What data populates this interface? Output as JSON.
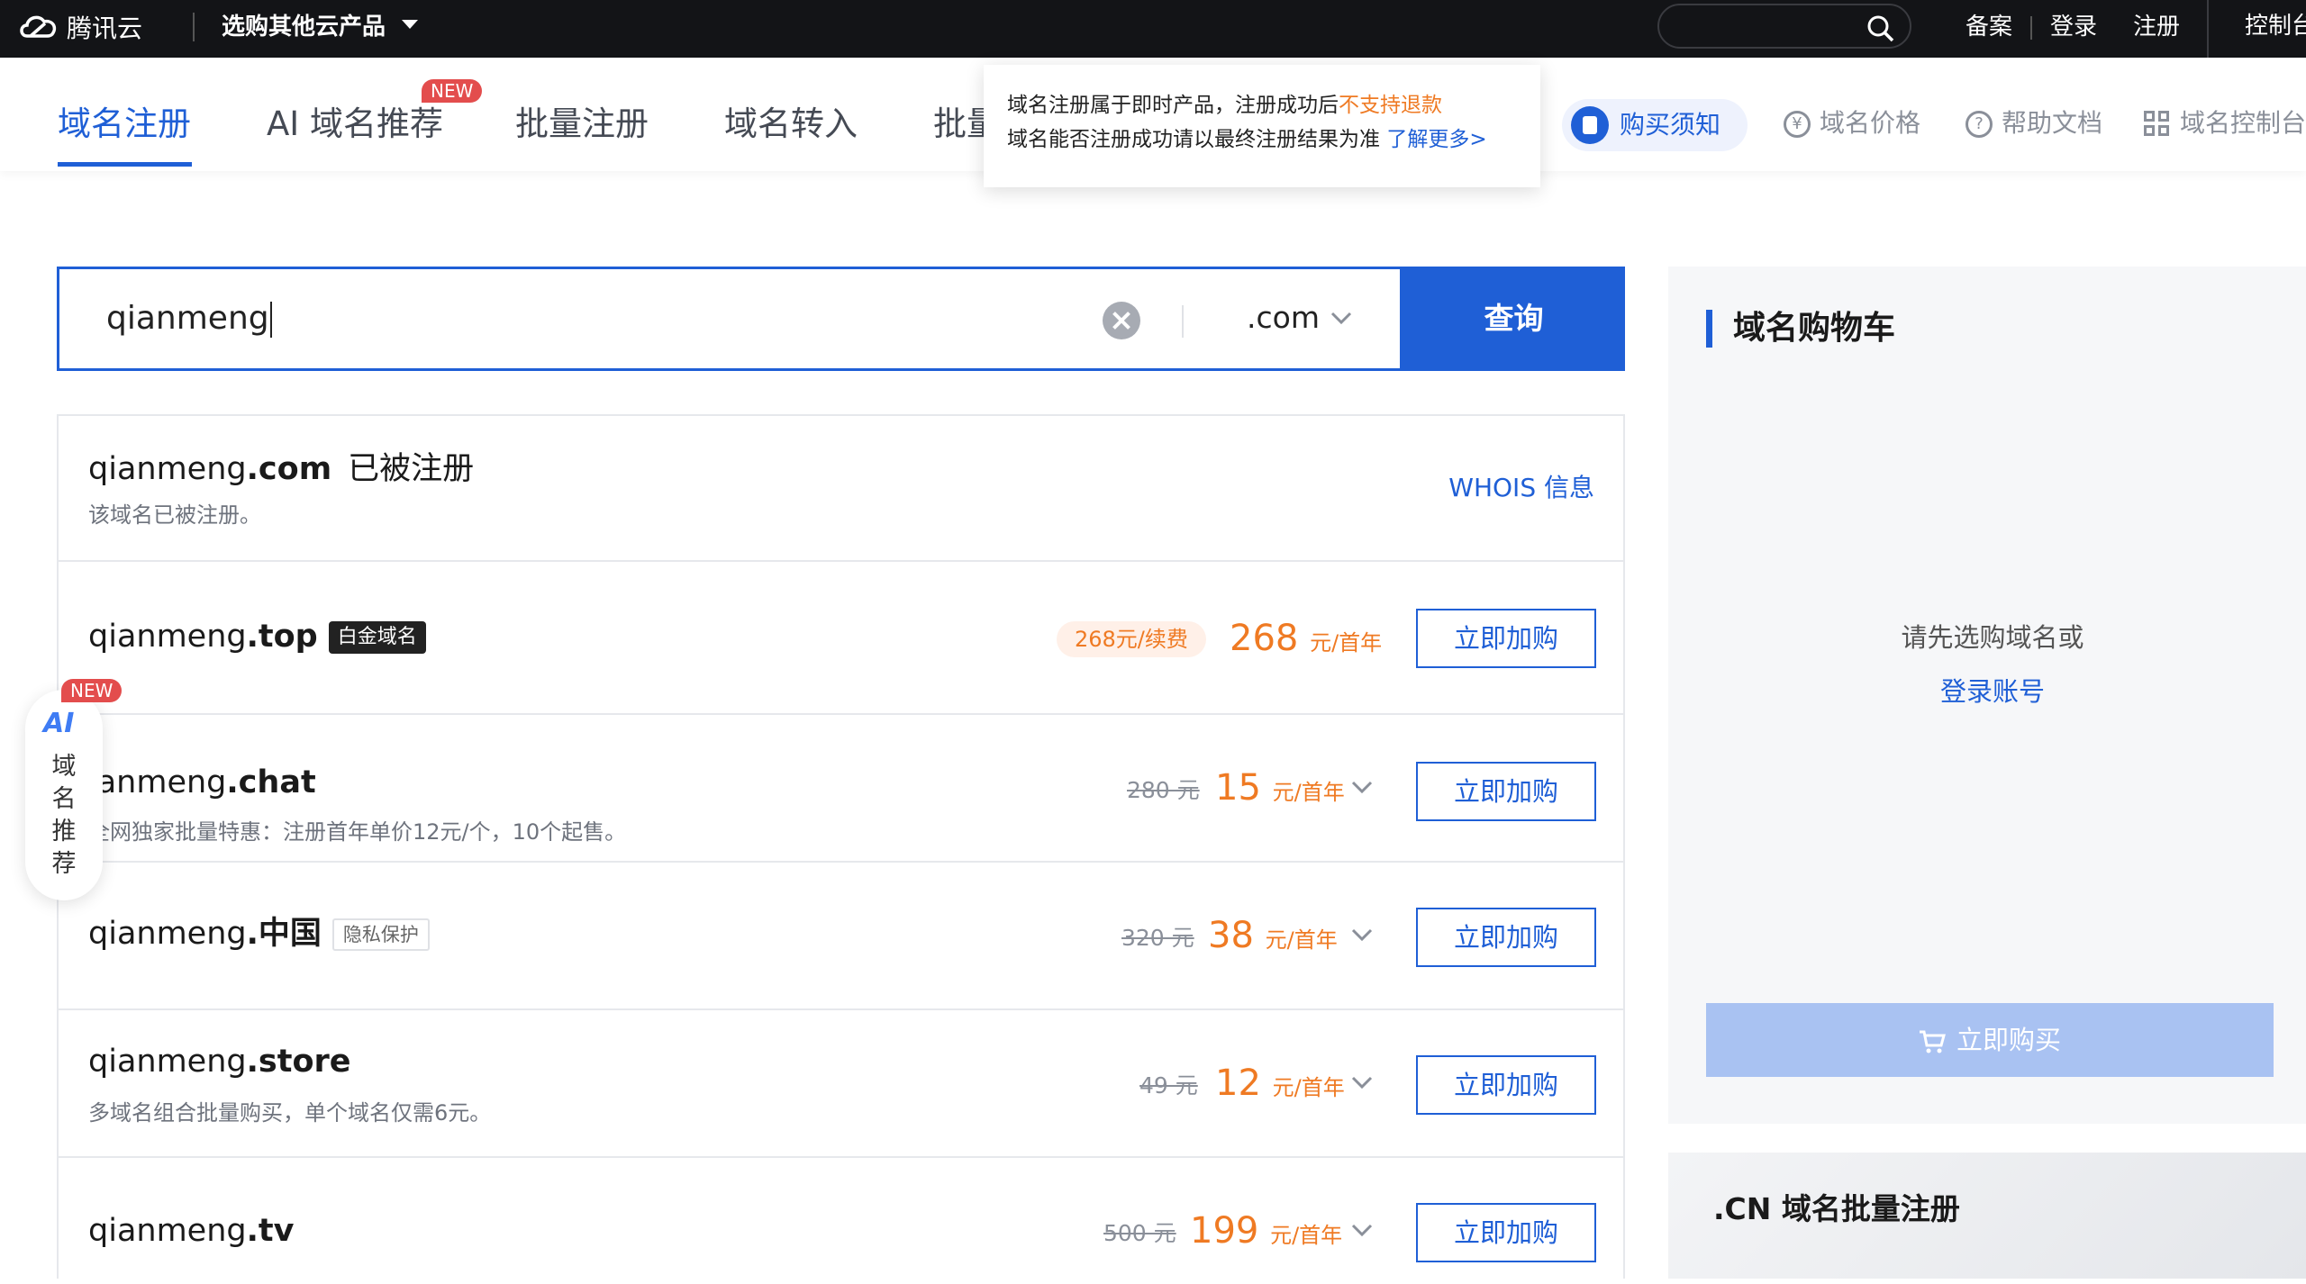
{
  "topbar": {
    "brand": "腾讯云",
    "products": "选购其他云产品",
    "search_placeholder": "",
    "links": [
      "备案",
      "登录",
      "注册"
    ],
    "console": "控制台"
  },
  "tabs": [
    {
      "label": "域名注册",
      "active": true
    },
    {
      "label": "AI 域名推荐",
      "badge": "NEW"
    },
    {
      "label": "批量注册"
    },
    {
      "label": "域名转入"
    },
    {
      "label": "批量"
    }
  ],
  "notice": {
    "line1_pre": "域名注册属于即时产品，注册成功后",
    "line1_warn": "不支持退款",
    "line2_pre": "域名能否注册成功请以最终注册结果为准",
    "line2_link": "了解更多>"
  },
  "tools": {
    "buy_notice": "购买须知",
    "price": "域名价格",
    "help": "帮助文档",
    "console": "域名控制台"
  },
  "search": {
    "query": "qianmeng",
    "tld": ".com",
    "button": "查询"
  },
  "results": [
    {
      "name": "qianmeng",
      "tld": ".com",
      "status": "已被注册",
      "sub": "该域名已被注册。",
      "whois": "WHOIS 信息"
    },
    {
      "name": "qianmeng",
      "tld": ".top",
      "tag": "白金域名",
      "renew": "268元/续费",
      "price": "268",
      "unit": "元/首年",
      "button": "立即加购"
    },
    {
      "name": "ianmeng",
      "tld": ".chat",
      "sub": "全网独家批量特惠：注册首年单价12元/个，10个起售。",
      "old_price": "280 元",
      "price": "15",
      "unit": "元/首年",
      "button": "立即加购"
    },
    {
      "name": "qianmeng",
      "tld": ".中国",
      "tag": "隐私保护",
      "old_price": "320 元",
      "price": "38",
      "unit": "元/首年",
      "button": "立即加购"
    },
    {
      "name": "qianmeng",
      "tld": ".store",
      "sub": "多域名组合批量购买，单个域名仅需6元。",
      "old_price": "49 元",
      "price": "12",
      "unit": "元/首年",
      "button": "立即加购"
    },
    {
      "name": "qianmeng",
      "tld": ".tv",
      "old_price": "500 元",
      "price": "199",
      "unit": "元/首年",
      "button": "立即加购"
    }
  ],
  "ai_float": {
    "badge": "NEW",
    "logo": "AI",
    "label": "域名推荐"
  },
  "cart": {
    "title": "域名购物车",
    "empty_line1": "请先选购域名或",
    "login_link": "登录账号",
    "buy_button": "立即购买",
    "promo_title": ".CN 域名批量注册"
  },
  "colors": {
    "brand_blue": "#1f5fd6",
    "orange": "#ef7a23",
    "topbar_bg": "#131417"
  }
}
